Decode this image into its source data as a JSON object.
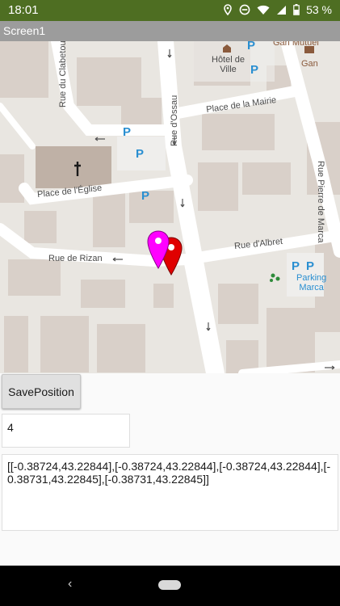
{
  "status_bar": {
    "time": "18:01",
    "battery": "53 %",
    "icons": [
      "location-icon",
      "do-not-disturb-icon",
      "wifi-icon",
      "signal-icon",
      "battery-icon"
    ]
  },
  "app": {
    "title": "Screen1"
  },
  "map": {
    "streets": {
      "clabetou": "Rue du Clabetou",
      "ossau": "Rue d'Ossau",
      "mairie": "Place de la Mairie",
      "eglise": "Place de l'Église",
      "rizan": "Rue de Rizan",
      "albret": "Rue d'Albret",
      "pierre_marca": "Rue Pierre de Marca"
    },
    "pois": {
      "hotel_de_ville": "Hôtel de\nVille",
      "gan": "Gan",
      "gan_mutuel": "Gan Mutuel",
      "parking_marca": "Parking\nMarca",
      "parking": "P"
    },
    "markers": [
      {
        "color": "#ff00ff",
        "name": "magenta"
      },
      {
        "color": "#e00000",
        "name": "red"
      }
    ],
    "colors": {
      "background": "#e9e6e1",
      "road": "#ffffff",
      "building": "#d9d0c9",
      "park": "#e5e5e5"
    }
  },
  "controls": {
    "save_label": "SavePosition",
    "count_value": "4",
    "positions_text": "[[-0.38724,43.22844],[-0.38724,43.22844],[-0.38724,43.22844],[-0.38731,43.22845],[-0.38731,43.22845]]"
  },
  "nav_bar": {
    "back_icon": "back-icon",
    "home_icon": "home-pill-icon"
  }
}
